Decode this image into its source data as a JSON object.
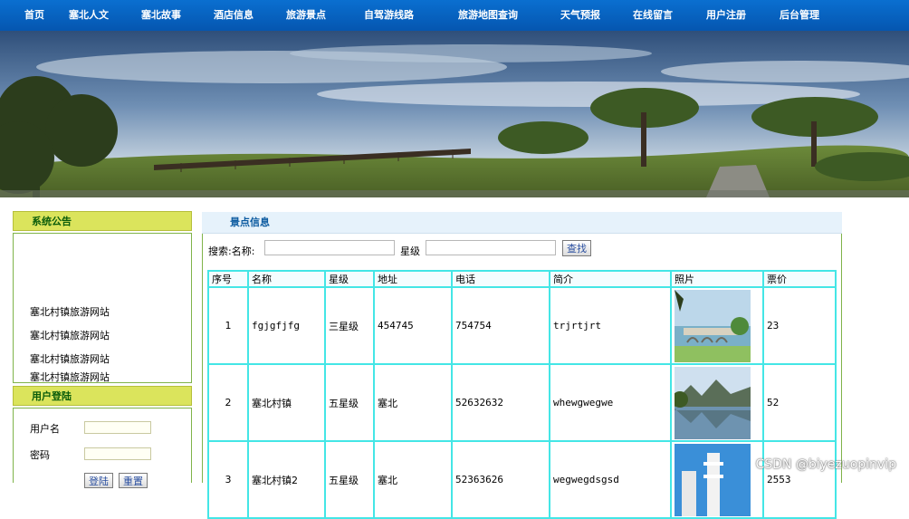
{
  "nav": {
    "items": [
      "首页",
      "塞北人文",
      "塞北故事",
      "酒店信息",
      "旅游景点",
      "自驾游线路",
      "旅游地图查询",
      "天气预报",
      "在线留言",
      "用户注册",
      "后台管理"
    ]
  },
  "notice": {
    "title": "系统公告",
    "items": [
      "塞北村镇旅游网站",
      "塞北村镇旅游网站",
      "塞北村镇旅游网站",
      "塞北村镇旅游网站"
    ]
  },
  "login": {
    "title": "用户登陆",
    "username_label": "用户名",
    "password_label": "密码",
    "login_button": "登陆",
    "reset_button": "重置"
  },
  "main": {
    "title": "景点信息",
    "search_label": "搜索:名称:",
    "star_label": "星级",
    "search_button": "查找",
    "columns": [
      "序号",
      "名称",
      "星级",
      "地址",
      "电话",
      "简介",
      "照片",
      "票价"
    ],
    "rows": [
      {
        "no": "1",
        "name": "fgjgfjfg",
        "star": "三星级",
        "address": "454745",
        "phone": "754754",
        "intro": "trjrtjrt",
        "price": "23"
      },
      {
        "no": "2",
        "name": "塞北村镇",
        "star": "五星级",
        "address": "塞北",
        "phone": "52632632",
        "intro": "whewgwegwe",
        "price": "52"
      },
      {
        "no": "3",
        "name": "塞北村镇2",
        "star": "五星级",
        "address": "塞北",
        "phone": "52363626",
        "intro": "wegwegdsgsd",
        "price": "2553"
      }
    ]
  },
  "watermark": "CSDN @biyezuopinvip",
  "colors": {
    "nav": "#0556b0",
    "panel_head": "#dbe45c",
    "table_border": "#44e6e6",
    "main_head": "#e6f2fb"
  }
}
